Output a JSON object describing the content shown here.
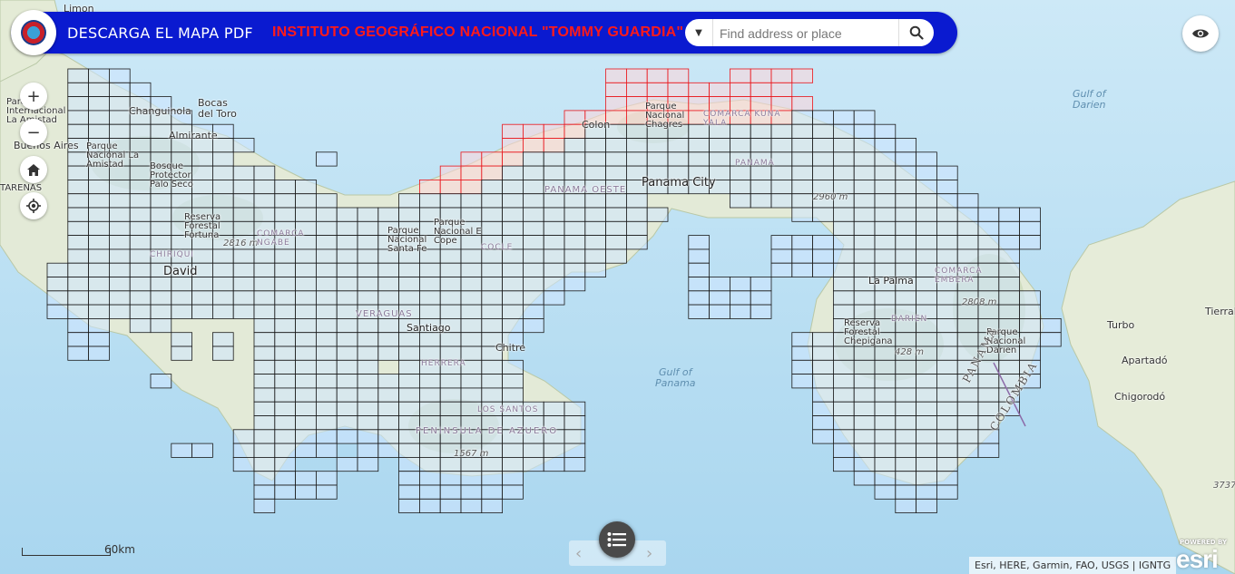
{
  "header": {
    "download_label": "DESCARGA EL MAPA PDF",
    "institute_title": "INSTITUTO GEOGRÁFICO NACIONAL \"TOMMY GUARDIA\"",
    "search_placeholder": "Find address or place"
  },
  "map_controls": {
    "zoom_in": "+",
    "zoom_out": "−"
  },
  "map_labels": {
    "limon": "Limon",
    "bocas_del_toro": "Bocas\ndel Toro",
    "changuinola": "Changuinola",
    "almirante": "Almirante",
    "parque_internacional": "Parque\nInternacional\nLa Amistad",
    "buenos_aires": "Buenos Aires",
    "parque_nacional_la_amistad": "Parque\nNacional La\nAmistad",
    "bosque_protector": "Bosque\nProtector\nPalo Seco",
    "tarenas": "TARENAS",
    "reserva_fortuna": "Reserva\nForestal\nFortuna",
    "elev_2816": "2816 m",
    "david": "David",
    "chiriqui": "CHIRIQUI",
    "comarca_ngabe": "COMARCA\nNGABE",
    "parque_santa_fe": "Parque\nNacional\nSanta Fe",
    "parque_omar": "Parque\nNacional E\nCope",
    "cocle": "COCLE",
    "veraguas": "VERAGUAS",
    "santiago": "Santiago",
    "chitre": "Chitre",
    "herrera": "HERRERA",
    "los_santos": "LOS SANTOS",
    "peninsula_azuero": "PENINSULA DE AZUERO",
    "elev_1567": "1567 m",
    "colon": "Colon",
    "parque_chagres": "Parque\nNacional\nChagres",
    "comarca_kuna": "COMARCA KUNA\nYALA",
    "panama_oeste": "PANAMA OESTE",
    "panama_city": "Panama City",
    "panama_region": "PANAMA",
    "elev_2960": "2960 m",
    "gulf_of_panama": "Gulf of\nPanama",
    "gulf_of_darien": "Gulf of\nDarien",
    "la_palma": "La Palma",
    "darien": "DARIEN",
    "reserva_chepigana": "Reserva\nForestal\nChepigana",
    "elev_428": "428 m",
    "elev_2808": "2808 m",
    "comarca_embera": "COMARCA\nEMBERA",
    "parque_darien": "Parque\nNacional\nDarien",
    "country_panama": "PANAMA",
    "country_colombia": "COLOMBIA",
    "turbo": "Turbo",
    "apartado": "Apartadó",
    "chigorodo": "Chigorodó",
    "tierral": "Tierral",
    "elev_3737": "3737"
  },
  "scale": {
    "label": "60km"
  },
  "attribution": "Esri, HERE, Garmin, FAO, USGS | IGNTG",
  "esri": {
    "powered_by": "POWERED BY",
    "wordmark": "esri"
  },
  "colors": {
    "header_bg": "#0a1ad0",
    "title_red": "#ff1a1a",
    "tile_fill": "#cfe6ff",
    "tile_stroke": "#1a1a1a",
    "tile_highlight_stroke": "#e8141a",
    "tile_highlight_fill": "#ffd6d9"
  }
}
